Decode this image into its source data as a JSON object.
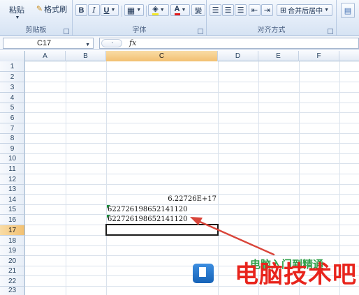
{
  "ribbon": {
    "clipboard": {
      "paste_label": "粘贴",
      "format_painter_label": "格式刷",
      "group_label": "剪贴板"
    },
    "font": {
      "bold": "B",
      "italic": "I",
      "underline": "U",
      "font_color_glyph": "A",
      "phonetic_glyph": "變",
      "group_label": "字体"
    },
    "alignment": {
      "merge_center_label": "合并后居中",
      "group_label": "对齐方式"
    }
  },
  "formula_bar": {
    "name_box_value": "C17",
    "fx_label": "fx",
    "formula_value": ""
  },
  "sheet": {
    "columns": [
      "A",
      "B",
      "C",
      "D",
      "E",
      "F"
    ],
    "active_column": "C",
    "rows": [
      "1",
      "2",
      "3",
      "4",
      "5",
      "6",
      "7",
      "8",
      "9",
      "10",
      "11",
      "12",
      "13",
      "14",
      "15",
      "16",
      "17",
      "18",
      "19",
      "20",
      "21",
      "22",
      "23"
    ],
    "active_row": "17",
    "cells": {
      "c14": "6.22726E+17",
      "c15": "622726198652141120",
      "c16": "622726198652141120"
    }
  },
  "watermark": {
    "main_text": "电脑技术吧",
    "sub_text": "电脑入门到精通"
  },
  "colors": {
    "accent": "#f2c071",
    "arrow": "#d9453a",
    "ribbon_bg": "#dfe9f5",
    "watermark_red": "#e8241c"
  }
}
